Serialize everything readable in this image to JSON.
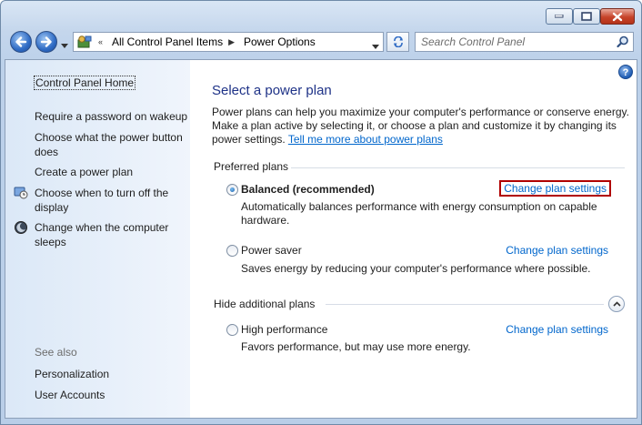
{
  "address": {
    "items": [
      "All Control Panel Items",
      "Power Options"
    ]
  },
  "search": {
    "placeholder": "Search Control Panel"
  },
  "sidebar": {
    "home": "Control Panel Home",
    "items": [
      {
        "label": "Require a password on wakeup"
      },
      {
        "label": "Choose what the power button does"
      },
      {
        "label": "Create a power plan"
      },
      {
        "label": "Choose when to turn off the display"
      },
      {
        "label": "Change when the computer sleeps"
      }
    ],
    "see_also": "See also",
    "see_also_items": [
      "Personalization",
      "User Accounts"
    ]
  },
  "main": {
    "title": "Select a power plan",
    "description": "Power plans can help you maximize your computer's performance or conserve energy. Make a plan active by selecting it, or choose a plan and customize it by changing its power settings.",
    "learn_more": "Tell me more about power plans",
    "preferred_header": "Preferred plans",
    "additional_header": "Hide additional plans",
    "plans": [
      {
        "name": "Balanced (recommended)",
        "description": "Automatically balances performance with energy consumption on capable hardware.",
        "change": "Change plan settings",
        "selected": true
      },
      {
        "name": "Power saver",
        "description": "Saves energy by reducing your computer's performance where possible.",
        "change": "Change plan settings",
        "selected": false
      },
      {
        "name": "High performance",
        "description": "Favors performance, but may use more energy.",
        "change": "Change plan settings",
        "selected": false
      }
    ]
  }
}
